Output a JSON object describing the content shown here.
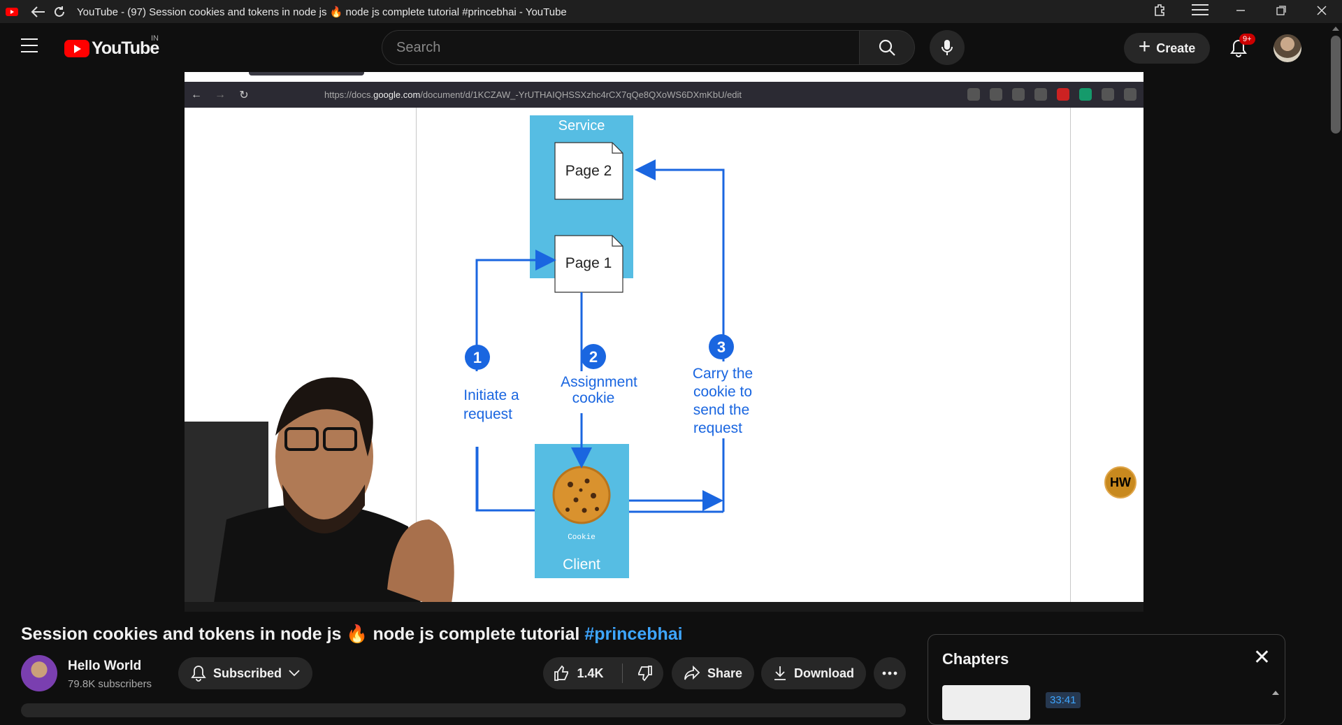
{
  "window": {
    "title": "YouTube - (97) Session cookies and tokens in node js 🔥 node js complete tutorial #princebhai - YouTube"
  },
  "masthead": {
    "logo_text": "YouTube",
    "country_code": "IN",
    "search_placeholder": "Search",
    "create_label": "Create",
    "notification_badge": "9+"
  },
  "browser": {
    "url_prefix": "https://docs.",
    "url_domain": "google.com",
    "url_path": "/document/d/1KCZAW_-YrUTHAIQHSSXzhc4rCX7qQe8QXoWS6DXmKbU/edit"
  },
  "diagram": {
    "service_label": "Service",
    "page2_label": "Page 2",
    "page1_label": "Page 1",
    "step1_number": "1",
    "step1_text_line1": "Initiate a",
    "step1_text_line2": "request",
    "step2_number": "2",
    "step2_text_line1": "Assignment",
    "step2_text_line2": "cookie",
    "step3_number": "3",
    "step3_text_line1": "Carry the",
    "step3_text_line2": "cookie to",
    "step3_text_line3": "send the",
    "step3_text_line4": "request",
    "cookie_label": "Cookie",
    "client_label": "Client"
  },
  "watermark": "HW",
  "video": {
    "title_main": "Session cookies and tokens in node js 🔥 node js complete tutorial",
    "title_tag": "#princebhai"
  },
  "channel": {
    "name": "Hello World",
    "subscribers": "79.8K subscribers",
    "subscribed_label": "Subscribed"
  },
  "actions": {
    "likes": "1.4K",
    "share_label": "Share",
    "download_label": "Download"
  },
  "chapters": {
    "title": "Chapters",
    "timestamp": "33:41"
  },
  "colors": {
    "accent": "#3ea6ff",
    "youtube_red": "#ff0000",
    "diagram_box": "#56bde3",
    "diagram_arrow": "#1a66e0"
  }
}
